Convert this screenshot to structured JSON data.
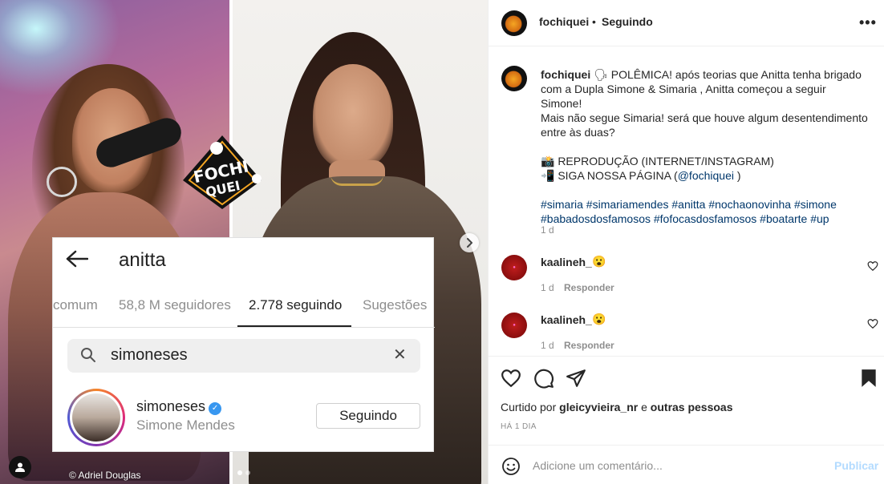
{
  "media": {
    "credit": "© Adriel Douglas",
    "badge_text_1": "FOCHI",
    "badge_text_2": "QUEI",
    "screenshot": {
      "title": "anitta",
      "tabs": [
        "comum",
        "58,8 M seguidores",
        "2.778 seguindo",
        "Sugestões"
      ],
      "active_tab": "2.778 seguindo",
      "search_value": "simoneses",
      "result_username": "simoneses",
      "result_fullname": "Simone Mendes",
      "result_button": "Seguindo"
    },
    "carousel_total": 2,
    "carousel_index": 1
  },
  "header": {
    "username": "fochiquei",
    "separator": "•",
    "follow_status": "Seguindo",
    "more": "•••"
  },
  "caption": {
    "username": "fochiquei",
    "text_lines": [
      "🗣 POLÊMICA! após teorias que Anitta tenha brigado",
      "com a Dupla Simone & Simaria , Anitta começou a seguir Simone!",
      "Mais não segue Simaria! será que houve algum desentendimento",
      "entre às duas?"
    ],
    "credit_line": "📸 REPRODUÇÃO (INTERNET/INSTAGRAM)",
    "follow_prefix": "📲 SIGA NOSSA PÁGINA (",
    "follow_handle": "@fochiquei",
    "follow_suffix": " )",
    "hashtags_line1": "#simaria #simariamendes #anitta #nochaonovinha #simone",
    "hashtags_line2": "#babadosdosfamosos #fofocasdosfamosos #boatarte #up",
    "time": "1 d"
  },
  "comments": [
    {
      "username": "kaalineh_",
      "text": "😮",
      "time": "1 d",
      "reply": "Responder"
    },
    {
      "username": "kaalineh_",
      "text": "😮",
      "time": "1 d",
      "reply": "Responder"
    }
  ],
  "likes": {
    "prefix": "Curtido por",
    "user": "gleicyvieira_nr",
    "middle": "e",
    "suffix": "outras pessoas",
    "ago": "HÁ 1 DIA"
  },
  "comment_box": {
    "placeholder": "Adicione um comentário...",
    "publish": "Publicar"
  },
  "colors": {
    "link": "#00376b",
    "publish_disabled": "#b3dbff",
    "verified": "#3897f0"
  }
}
